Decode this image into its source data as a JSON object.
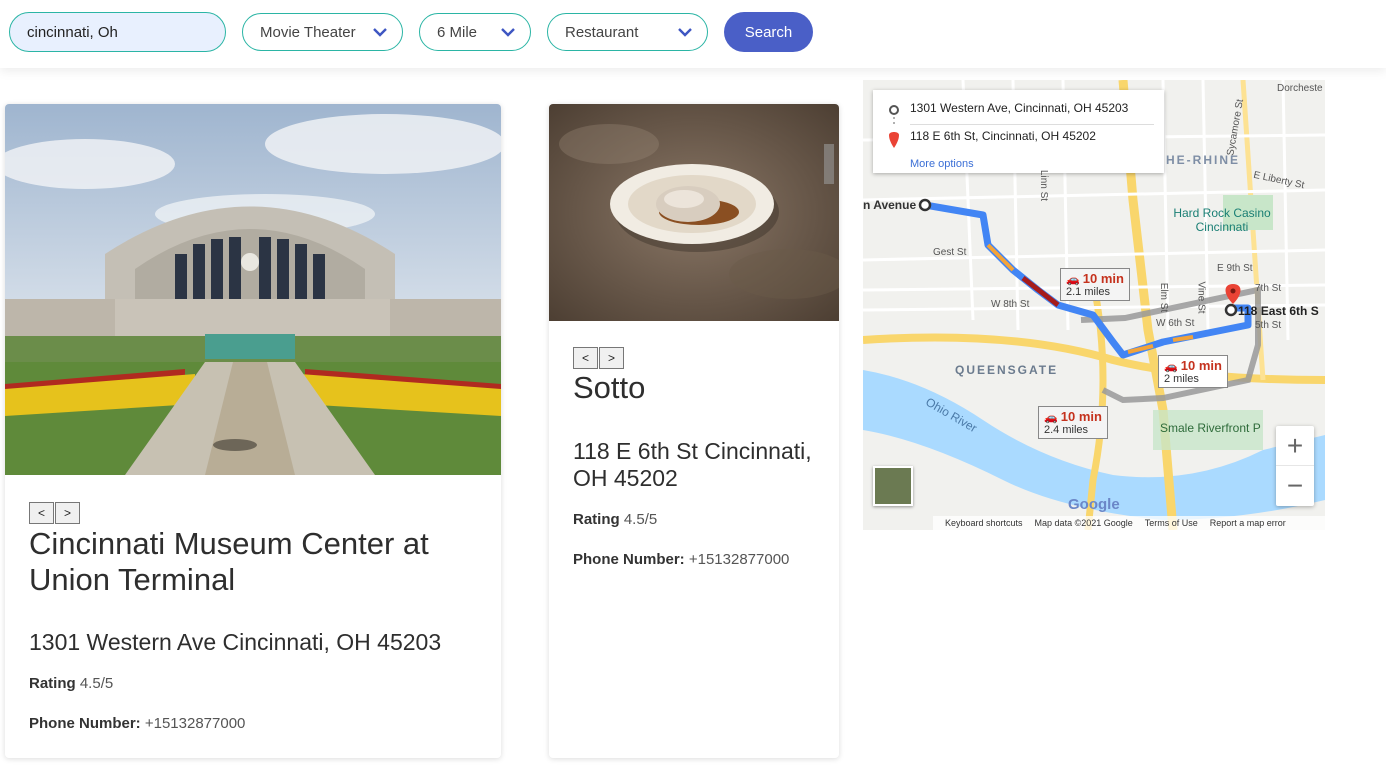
{
  "search": {
    "value": "cincinnati, Oh"
  },
  "filters": {
    "category": "Movie Theater",
    "distance": "6 Mile",
    "second_category": "Restaurant",
    "search_label": "Search"
  },
  "cards": [
    {
      "name": "Cincinnati Museum Center at Union Terminal",
      "address": "1301 Western Ave Cincinnati, OH 45203",
      "rating_label": "Rating",
      "rating": "4.5/5",
      "phone_label": "Phone Number:",
      "phone": "+15132877000",
      "prev": "<",
      "next": ">"
    },
    {
      "name": "Sotto",
      "address": "118 E 6th St Cincinnati, OH 45202",
      "rating_label": "Rating",
      "rating": "4.5/5",
      "phone_label": "Phone Number:",
      "phone": "+15132877000",
      "prev": "<",
      "next": ">"
    }
  ],
  "map": {
    "origin": "1301 Western Ave, Cincinnati, OH 45203",
    "destination": "118 E 6th St, Cincinnati, OH 45202",
    "more_options": "More options",
    "routes": [
      {
        "time": "10 min",
        "distance": "2.1 miles"
      },
      {
        "time": "10 min",
        "distance": "2 miles"
      },
      {
        "time": "10 min",
        "distance": "2.4 miles"
      }
    ],
    "labels": {
      "avenue": "n Avenue",
      "otr": "HE-RHINE",
      "hard_rock": "Hard Rock Casino Cincinnati",
      "queensgate": "QUEENSGATE",
      "ohio_river": "Ohio River",
      "smale": "Smale Riverfront P",
      "dest_label": "118 East 6th S",
      "gest": "Gest St",
      "w8th": "W 8th St",
      "e9th": "E 9th St",
      "elm": "Elm St",
      "vine": "Vine St",
      "w6th": "W 6th St",
      "e7th": "7th St",
      "e6th": "5th St",
      "eliberty": "E Liberty St",
      "dorchester": "Dorcheste",
      "sycamore": "Sycamore St",
      "linn": "Linn St",
      "google": "Google"
    },
    "footer": {
      "shortcuts": "Keyboard shortcuts",
      "data": "Map data ©2021 Google",
      "terms": "Terms of Use",
      "report": "Report a map error"
    },
    "zoom_in": "+",
    "zoom_out": "−"
  }
}
